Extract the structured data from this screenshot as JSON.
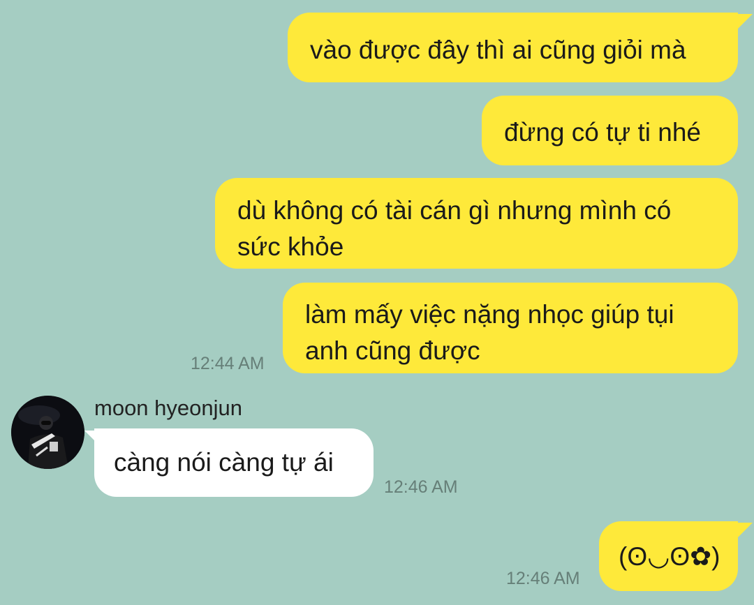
{
  "chat": {
    "messages": [
      {
        "direction": "outgoing",
        "text": "vào được đây thì ai cũng giỏi mà"
      },
      {
        "direction": "outgoing",
        "text": "đừng có tự ti nhé"
      },
      {
        "direction": "outgoing",
        "text": "dù không có tài cán gì nhưng mình có sức khỏe"
      },
      {
        "direction": "outgoing",
        "text": "làm mấy việc nặng nhọc giúp tụi anh cũng được",
        "time": "12:44 AM"
      },
      {
        "direction": "incoming",
        "sender": "moon hyeonjun",
        "avatar_icon": "user-avatar-icon",
        "text": "càng nói càng tự ái",
        "time": "12:46 AM"
      },
      {
        "direction": "outgoing",
        "text": "(ʘ◡ʘ✿)",
        "time": "12:46 AM"
      }
    ]
  },
  "colors": {
    "background": "#a5cdc2",
    "outgoing_bubble": "#fee93a",
    "incoming_bubble": "#ffffff",
    "timestamp": "#667f78"
  }
}
